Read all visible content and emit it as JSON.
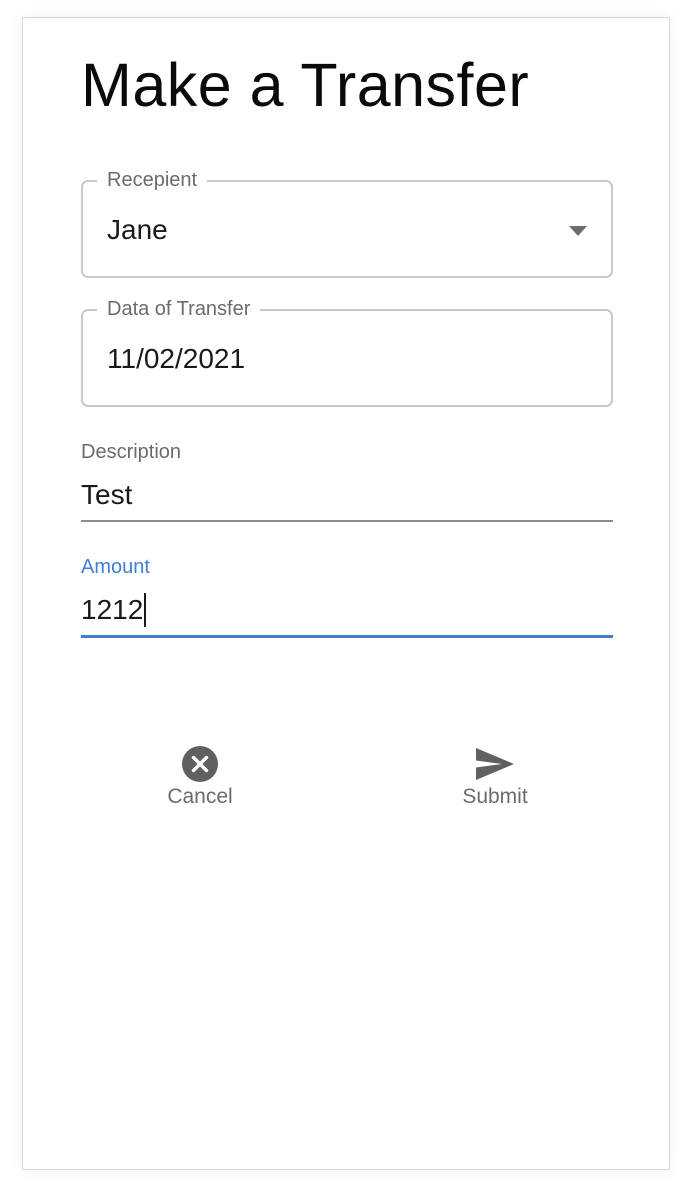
{
  "page": {
    "title": "Make a Transfer"
  },
  "recipient": {
    "label": "Recepient",
    "value": "Jane"
  },
  "transfer_date": {
    "label": "Data of Transfer",
    "value": "11/02/2021"
  },
  "description": {
    "label": "Description",
    "value": "Test"
  },
  "amount": {
    "label": "Amount",
    "value": "1212"
  },
  "actions": {
    "cancel": {
      "label": "Cancel",
      "icon": "cancel-circle-icon"
    },
    "submit": {
      "label": "Submit",
      "icon": "send-icon"
    }
  },
  "colors": {
    "accent": "#3f7ed3",
    "text": "#1a1a1a",
    "muted": "#6b6b6b",
    "icon": "#606060"
  }
}
